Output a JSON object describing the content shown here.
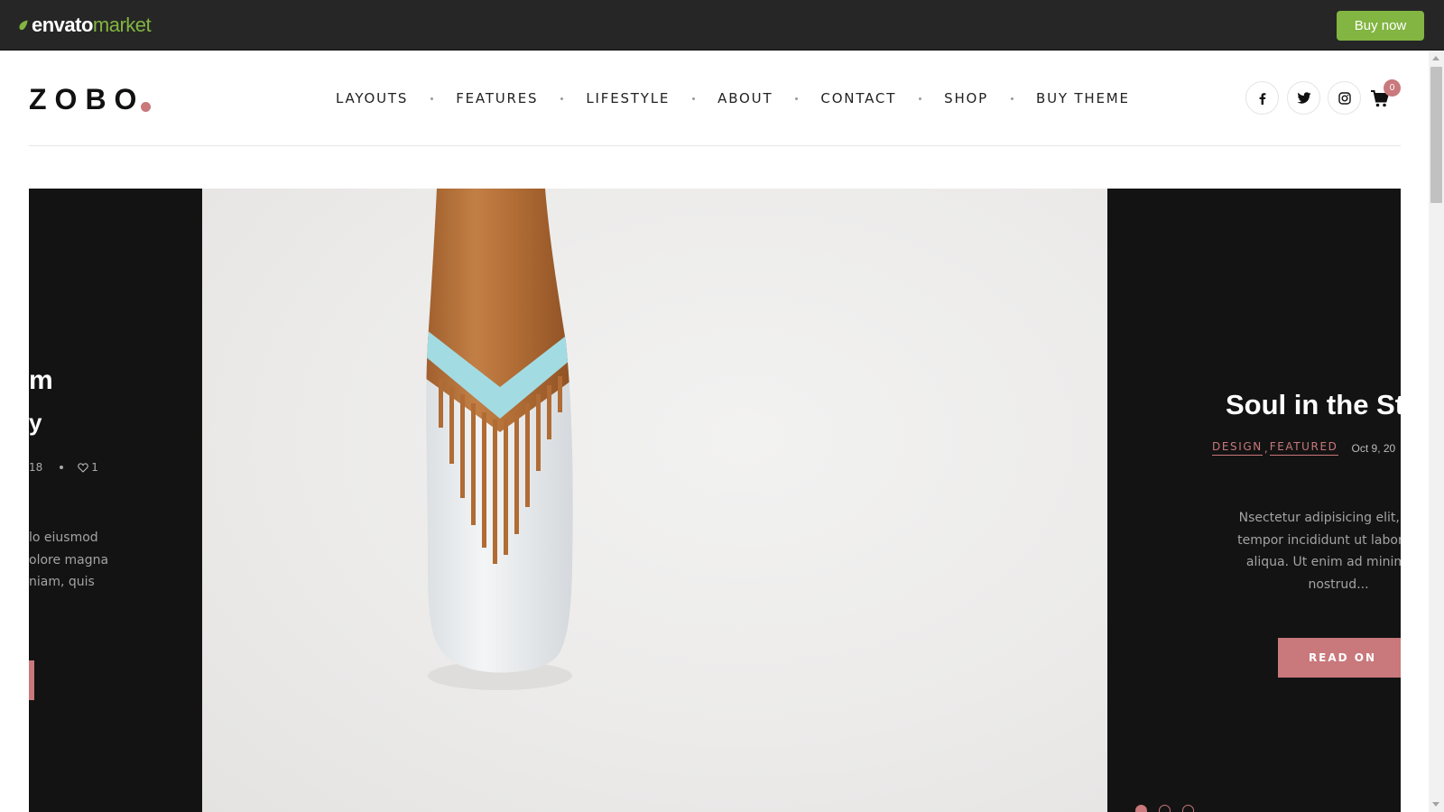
{
  "envato_bar": {
    "logo_envato": "envato",
    "logo_market": "market",
    "buy_now_label": "Buy now",
    "accent": "#82b541"
  },
  "site": {
    "logo_text": "ZOBO",
    "accent": "#c9787b"
  },
  "nav": {
    "items": [
      {
        "label": "LAYOUTS"
      },
      {
        "label": "FEATURES"
      },
      {
        "label": "LIFESTYLE"
      },
      {
        "label": "ABOUT"
      },
      {
        "label": "CONTACT"
      },
      {
        "label": "SHOP"
      },
      {
        "label": "BUY THEME"
      }
    ]
  },
  "header_icons": {
    "social": [
      "facebook-icon",
      "twitter-icon",
      "instagram-icon"
    ],
    "cart_icon": "cart-icon",
    "cart_count": "0"
  },
  "slider": {
    "left_slide": {
      "title_line1": "m",
      "title_line2": "y",
      "date_fragment": "18",
      "likes": "1",
      "excerpt_lines": [
        "lo eiusmod",
        "olore magna",
        "niam, quis"
      ]
    },
    "right_slide": {
      "title": "Soul in the Sto",
      "categories": [
        "DESIGN",
        "FEATURED"
      ],
      "date": "Oct 9, 20",
      "excerpt": "Nsectetur adipisicing elit, sed d\ntempor incididunt ut labore et d\naliqua. Ut enim ad minim ver\nnostrud...",
      "read_on_label": "READ ON"
    },
    "pager": {
      "count": 3,
      "active": 0
    }
  }
}
